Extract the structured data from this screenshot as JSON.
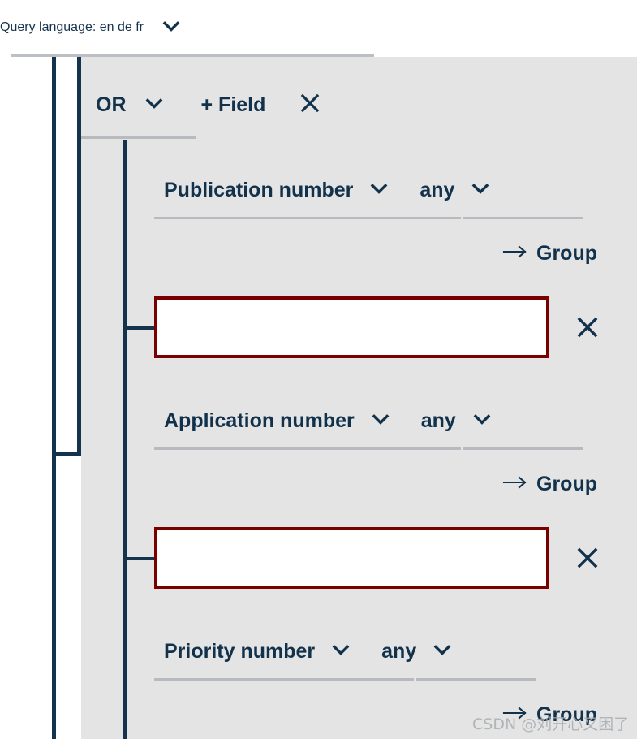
{
  "header": {
    "title": "Query language: en de fr",
    "chevron_icon": "chevron-down-icon"
  },
  "group": {
    "operator": "OR",
    "operator_chevron_icon": "chevron-down-icon",
    "add_field_label": "+ Field",
    "remove_icon": "close-icon"
  },
  "colors": {
    "panel_background": "#e4e4e4",
    "tree_line": "#15334c",
    "text": "#12324c",
    "underline": "#b7bbbf",
    "input_border_error": "#7a0000",
    "input_background": "#ffffff",
    "watermark": "#a9adb1"
  },
  "fields": [
    {
      "name": "Publication number",
      "name_chevron_icon": "chevron-down-icon",
      "operator": "any",
      "operator_chevron_icon": "chevron-down-icon",
      "group_arrow_icon": "arrow-right-icon",
      "group_label": "Group",
      "value": "",
      "placeholder": "",
      "remove_icon": "close-icon"
    },
    {
      "name": "Application number",
      "name_chevron_icon": "chevron-down-icon",
      "operator": "any",
      "operator_chevron_icon": "chevron-down-icon",
      "group_arrow_icon": "arrow-right-icon",
      "group_label": "Group",
      "value": "",
      "placeholder": "",
      "remove_icon": "close-icon"
    },
    {
      "name": "Priority number",
      "name_chevron_icon": "chevron-down-icon",
      "operator": "any",
      "operator_chevron_icon": "chevron-down-icon",
      "group_arrow_icon": "arrow-right-icon",
      "group_label": "Group"
    }
  ],
  "watermark": {
    "text": "CSDN @刘开心又困了"
  }
}
